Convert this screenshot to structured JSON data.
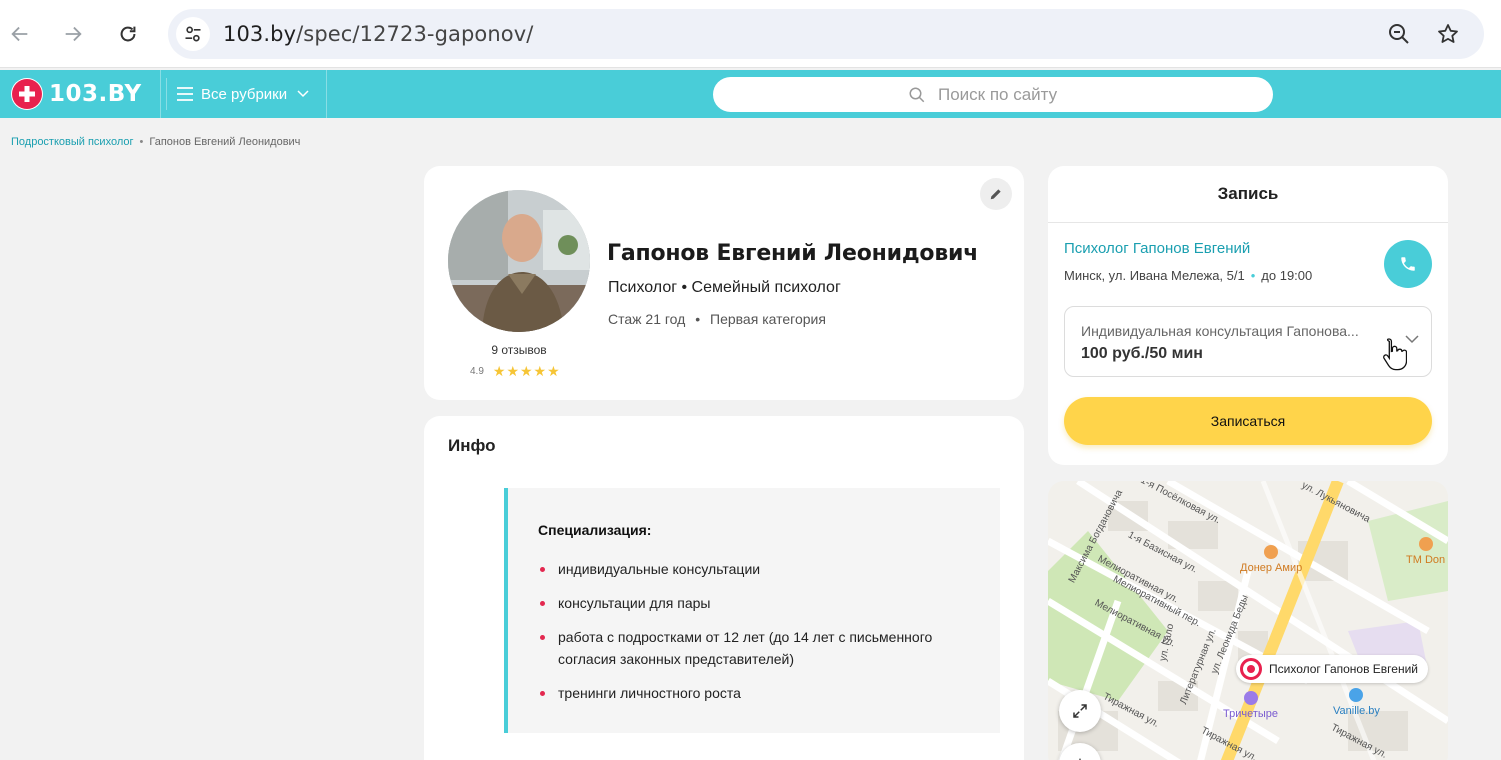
{
  "browser": {
    "url_host": "103.by",
    "url_path": "/spec/12723-gaponov/"
  },
  "header": {
    "logo_text": "103.BY",
    "rubrics_label": "Все рубрики",
    "search_placeholder": "Поиск по сайту"
  },
  "breadcrumb": {
    "items": [
      {
        "label": "Подростковый психолог",
        "link": true
      },
      {
        "label": "Гапонов Евгений Леонидович",
        "link": false
      }
    ]
  },
  "profile": {
    "name": "Гапонов Евгений Леонидович",
    "specialties": "Психолог • Семейный психолог",
    "experience": "Стаж 21 год",
    "category": "Первая категория",
    "reviews": "9 отзывов",
    "rating": "4.9",
    "stars": 5
  },
  "info": {
    "title": "Инфо",
    "spec_heading": "Специализация:",
    "spec_items": [
      "индивидуальные консультации",
      "консультации для пары",
      "работа с подростками от 12 лет (до 14 лет с письменного согласия законных представителей)",
      "тренинги личностного роста"
    ]
  },
  "booking": {
    "title": "Запись",
    "clinic_name": "Психолог Гапонов Евгений",
    "address": "Минск, ул. Ивана Мележа, 5/1",
    "hours": "до 19:00",
    "service_name": "Индивидуальная консультация Гапонова...",
    "service_price": "100 руб./50 мин",
    "book_label": "Записаться"
  },
  "map": {
    "pin_label": "Психолог Гапонов Евгений",
    "streets": [
      "ул. Лукьяновича",
      "1-я Посёлковая ул.",
      "Максима Богдановича",
      "1-я Базисная ул.",
      "Мелиоративная ул.",
      "Мелиоративный пер.",
      "Мелиоративная ул.",
      "ул. Леонида Беды",
      "Литературная ул.",
      "ул. Гало",
      "Тиражная ул.",
      "Тиражная ул.",
      "Тиражная ул."
    ],
    "pois": [
      {
        "name": "Донер Амир",
        "color": "#f0a050"
      },
      {
        "name": "ТМ Don",
        "color": "#f0a050"
      },
      {
        "name": "Тричетыре",
        "color": "#9a7be8"
      },
      {
        "name": "Vanille.by",
        "color": "#4aa3e8"
      }
    ]
  },
  "colors": {
    "brand": "#49cdd8",
    "accent_button": "#ffd44a",
    "link": "#1a9fb0",
    "star": "#f6c536",
    "bullet": "#e3284f"
  }
}
